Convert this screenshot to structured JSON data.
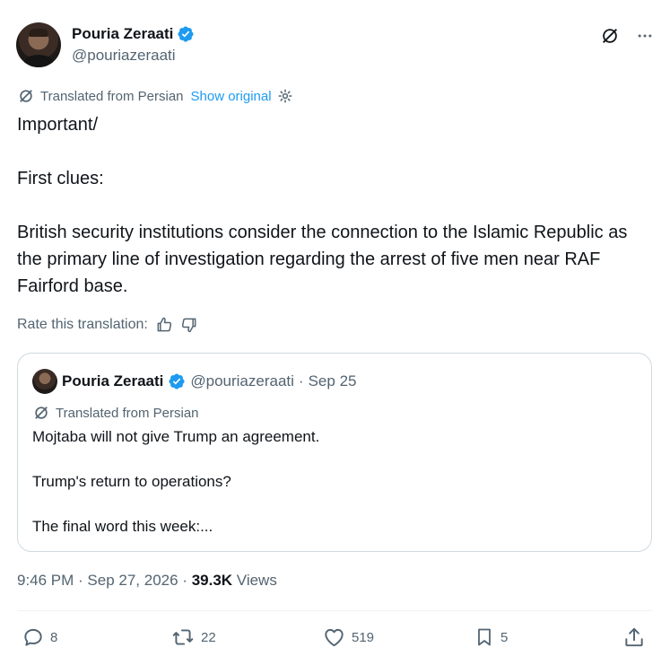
{
  "author": {
    "name": "Pouria Zeraati",
    "handle": "@pouriazeraati"
  },
  "translation": {
    "label": "Translated from Persian",
    "show_original": "Show original"
  },
  "post": {
    "lines": [
      "Important/",
      "First clues:",
      "British security institutions consider the connection to the Islamic Republic as the primary line of investigation regarding the arrest of five men near RAF Fairford base."
    ]
  },
  "rate": {
    "label": "Rate this translation:"
  },
  "quote": {
    "name": "Pouria Zeraati",
    "handle": "@pouriazeraati",
    "separator": "·",
    "date": "Sep 25",
    "translated_label": "Translated from Persian",
    "lines": [
      "Mojtaba will not give Trump an agreement.",
      "Trump's return to operations?",
      "The final word this week:..."
    ]
  },
  "meta": {
    "time_date": "9:46 PM · Sep 27, 2026 ·",
    "views_count": "39.3K",
    "views_label": "Views"
  },
  "actions": {
    "replies": "8",
    "reposts": "22",
    "likes": "519",
    "bookmarks": "5"
  },
  "colors": {
    "text": "#0f1419",
    "secondary": "#536471",
    "accent": "#1d9bf0",
    "border": "#cfd9de"
  }
}
